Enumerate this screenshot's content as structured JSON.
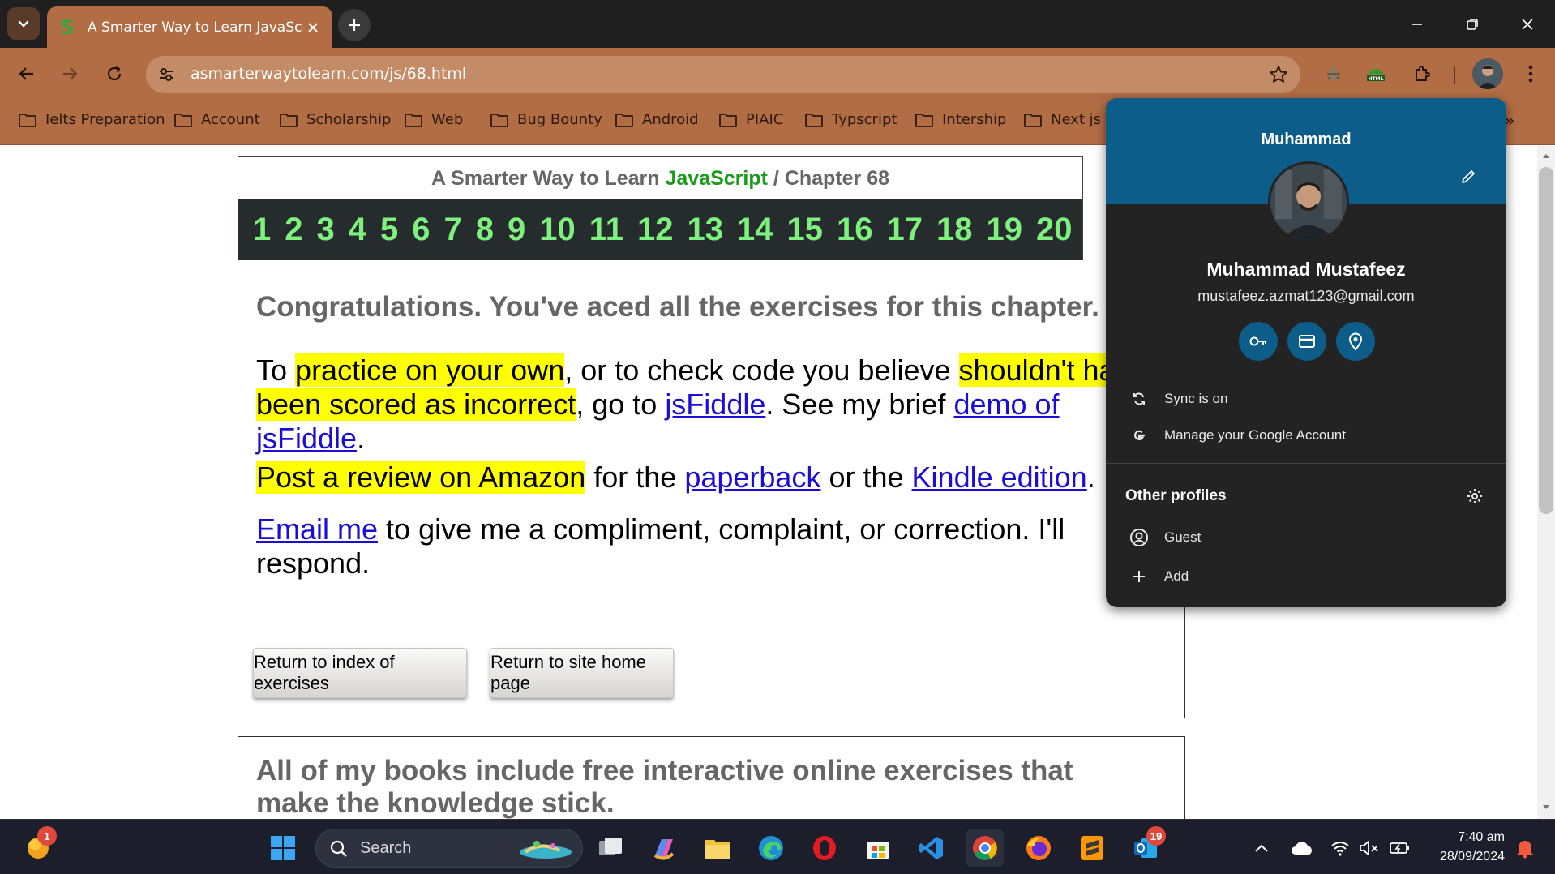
{
  "browser": {
    "tab_title": "A Smarter Way to Learn JavaScr",
    "tab_favicon_letter": "S",
    "url": "asmarterwaytolearn.com/js/68.html",
    "accent_color": "#b36d44"
  },
  "bookmarks": [
    "Ielts Preparation",
    "Account",
    "Scholarship",
    "Web",
    "Bug Bounty",
    "Android",
    "PIAIC",
    "Typscript",
    "Intership",
    "Next js"
  ],
  "page": {
    "title_prefix": "A Smarter Way to Learn",
    "title_js": "JavaScript",
    "title_sep": "/",
    "title_chapter": "Chapter 68",
    "chapter_numbers": [
      "1",
      "2",
      "3",
      "4",
      "5",
      "6",
      "7",
      "8",
      "9",
      "10",
      "11",
      "12",
      "13",
      "14",
      "15",
      "16",
      "17",
      "18",
      "19",
      "20"
    ],
    "congrats": "Congratulations. You've aced all the exercises for this chapter.",
    "p1_to": "To",
    "p1_hl1": "practice on your own",
    "p1_mid": ", or to check code you believe",
    "p1_hl2": "shouldn't have been scored as incorrect",
    "p1_goto": ", go to",
    "p1_link1": "jsFiddle",
    "p1_see": ". See my brief",
    "p1_link2": "demo of jsFiddle",
    "p1_end": ".",
    "p2_hl": "Post a review on Amazon",
    "p2_for": "for the",
    "p2_link1": "paperback",
    "p2_or": "or the",
    "p2_link2": "Kindle edition",
    "p2_end": ".",
    "p3_link": "Email me",
    "p3_text": "to give me a compliment, complaint, or correction. I'll respond.",
    "btn_index": "Return to index of exercises",
    "btn_home": "Return to site home page",
    "books_text": "All of my books include free interactive online exercises that make the knowledge stick."
  },
  "profile": {
    "first_name": "Muhammad",
    "full_name": "Muhammad Mustafeez",
    "email": "mustafeez.azmat123@gmail.com",
    "sync": "Sync is on",
    "manage": "Manage your Google Account",
    "other_profiles": "Other profiles",
    "guest": "Guest",
    "add": "Add"
  },
  "taskbar": {
    "search": "Search",
    "notif_badge": "1",
    "outlook_badge": "19",
    "time": "7:40 am",
    "date": "28/09/2024"
  }
}
